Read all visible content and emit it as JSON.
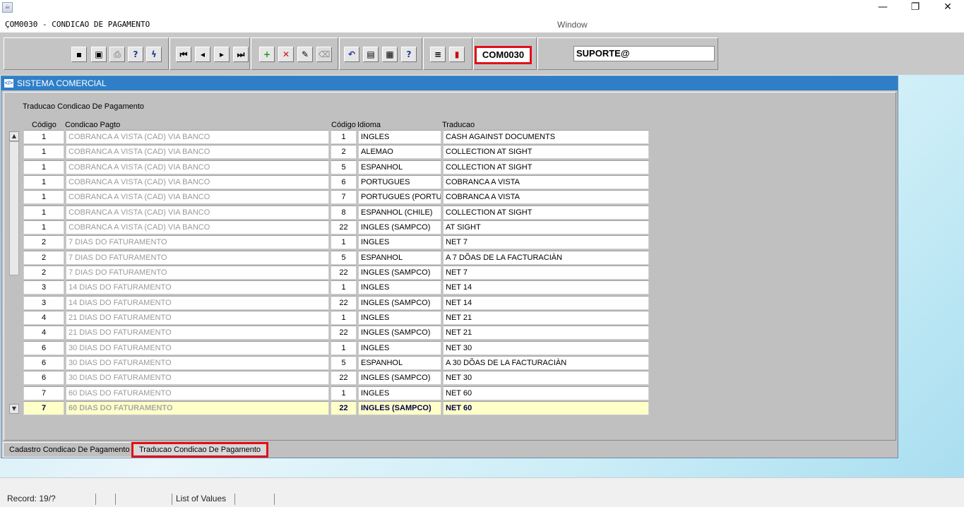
{
  "window": {
    "java_icon": "java-icon",
    "minimize": "—",
    "maximize": "❐",
    "close": "✕"
  },
  "menu": {
    "form_title": "ÇOM0030 - CONDICAO DE PAGAMENTO",
    "window_label": "Window"
  },
  "toolbar": {
    "module_code": "COM0030",
    "user": "SUPORTE@",
    "buttons": [
      "save",
      "print-screen",
      "print",
      "query",
      "execute-query",
      "first-record",
      "previous-record",
      "next-record",
      "last-record",
      "insert-record",
      "delete-record",
      "edit",
      "clear",
      "undo",
      "list-of-values",
      "lov-edit",
      "help",
      "menu",
      "exit"
    ]
  },
  "main": {
    "caption": "SISTEMA COMERCIAL",
    "section_title": "Traducao Condicao De Pagamento",
    "headers": {
      "codigo": "Código",
      "condicao": "Condicao Pagto",
      "codigo_idioma": "Código",
      "idioma": "Idioma",
      "traducao": "Traducao"
    },
    "rows": [
      {
        "codigo": "1",
        "condicao": "COBRANCA A VISTA (CAD) VIA BANCO",
        "cod_idioma": "1",
        "idioma": "INGLES",
        "traducao": "CASH AGAINST DOCUMENTS"
      },
      {
        "codigo": "1",
        "condicao": "COBRANCA A VISTA (CAD) VIA BANCO",
        "cod_idioma": "2",
        "idioma": "ALEMAO",
        "traducao": "COLLECTION AT SIGHT"
      },
      {
        "codigo": "1",
        "condicao": "COBRANCA A VISTA (CAD) VIA BANCO",
        "cod_idioma": "5",
        "idioma": "ESPANHOL",
        "traducao": "COLLECTION AT SIGHT"
      },
      {
        "codigo": "1",
        "condicao": "COBRANCA A VISTA (CAD) VIA BANCO",
        "cod_idioma": "6",
        "idioma": "PORTUGUES",
        "traducao": "COBRANCA A VISTA"
      },
      {
        "codigo": "1",
        "condicao": "COBRANCA A VISTA (CAD) VIA BANCO",
        "cod_idioma": "7",
        "idioma": "PORTUGUES (PORTUGAL)",
        "traducao": "COBRANCA A VISTA"
      },
      {
        "codigo": "1",
        "condicao": "COBRANCA A VISTA (CAD) VIA BANCO",
        "cod_idioma": "8",
        "idioma": "ESPANHOL (CHILE)",
        "traducao": "COLLECTION AT SIGHT"
      },
      {
        "codigo": "1",
        "condicao": "COBRANCA A VISTA (CAD) VIA BANCO",
        "cod_idioma": "22",
        "idioma": "INGLES (SAMPCO)",
        "traducao": "AT SIGHT"
      },
      {
        "codigo": "2",
        "condicao": "7 DIAS DO FATURAMENTO",
        "cod_idioma": "1",
        "idioma": "INGLES",
        "traducao": "NET 7"
      },
      {
        "codigo": "2",
        "condicao": "7 DIAS DO FATURAMENTO",
        "cod_idioma": "5",
        "idioma": "ESPANHOL",
        "traducao": "A 7 DÕAS DE LA FACTURACIÀN"
      },
      {
        "codigo": "2",
        "condicao": "7 DIAS DO FATURAMENTO",
        "cod_idioma": "22",
        "idioma": "INGLES (SAMPCO)",
        "traducao": "NET 7"
      },
      {
        "codigo": "3",
        "condicao": "14 DIAS DO FATURAMENTO",
        "cod_idioma": "1",
        "idioma": "INGLES",
        "traducao": "NET 14"
      },
      {
        "codigo": "3",
        "condicao": "14 DIAS DO FATURAMENTO",
        "cod_idioma": "22",
        "idioma": "INGLES (SAMPCO)",
        "traducao": "NET 14"
      },
      {
        "codigo": "4",
        "condicao": "21 DIAS DO FATURAMENTO",
        "cod_idioma": "1",
        "idioma": "INGLES",
        "traducao": "NET 21"
      },
      {
        "codigo": "4",
        "condicao": "21 DIAS DO FATURAMENTO",
        "cod_idioma": "22",
        "idioma": "INGLES (SAMPCO)",
        "traducao": "NET 21"
      },
      {
        "codigo": "6",
        "condicao": "30 DIAS DO FATURAMENTO",
        "cod_idioma": "1",
        "idioma": "INGLES",
        "traducao": "NET 30"
      },
      {
        "codigo": "6",
        "condicao": "30 DIAS DO FATURAMENTO",
        "cod_idioma": "5",
        "idioma": "ESPANHOL",
        "traducao": "A 30 DÕAS DE LA FACTURACIÀN"
      },
      {
        "codigo": "6",
        "condicao": "30 DIAS DO FATURAMENTO",
        "cod_idioma": "22",
        "idioma": "INGLES (SAMPCO)",
        "traducao": "NET 30"
      },
      {
        "codigo": "7",
        "condicao": "60 DIAS DO FATURAMENTO",
        "cod_idioma": "1",
        "idioma": "INGLES",
        "traducao": "NET 60"
      },
      {
        "codigo": "7",
        "condicao": "60 DIAS DO FATURAMENTO",
        "cod_idioma": "22",
        "idioma": "INGLES (SAMPCO)",
        "traducao": "NET 60"
      }
    ],
    "current_row": 18
  },
  "tabs": [
    {
      "label": "Cadastro Condicao De Pagamento"
    },
    {
      "label": "Traducao Condicao De Pagamento"
    }
  ],
  "status": {
    "record": "Record: 19/?",
    "lov": "List of Values"
  }
}
